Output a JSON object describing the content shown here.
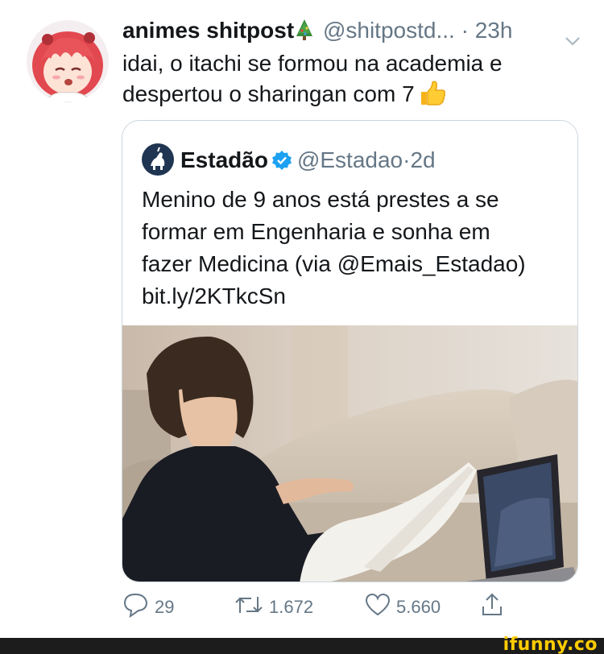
{
  "tweet": {
    "author_name": "animes shitpost",
    "author_handle": "@shitpostd...",
    "separator": "·",
    "time": "23h",
    "text": "idai, o itachi se formou na academia e despertou o sharingan com 7",
    "icons": [
      "christmas-tree-emoji",
      "thumbs-up-emoji",
      "chevron-down-icon"
    ]
  },
  "quote": {
    "author_name": "Estadão",
    "author_handle": "@Estadao",
    "separator": "·",
    "time": "2d",
    "text_lines": [
      "Menino de 9 anos está prestes a se",
      "formar em Engenharia e sonha em",
      "fazer Medicina (via @Emais_Estadao)",
      "bit.ly/2KTkcSn"
    ]
  },
  "actions": {
    "replies": "29",
    "retweets": "1.672",
    "likes": "5.660"
  },
  "footer": {
    "watermark": "ifunny.co"
  },
  "colors": {
    "text": "#14171a",
    "secondary": "#657786",
    "border": "#ccd6dd",
    "verified": "#1da1f2",
    "watermark": "#ffcc00"
  }
}
